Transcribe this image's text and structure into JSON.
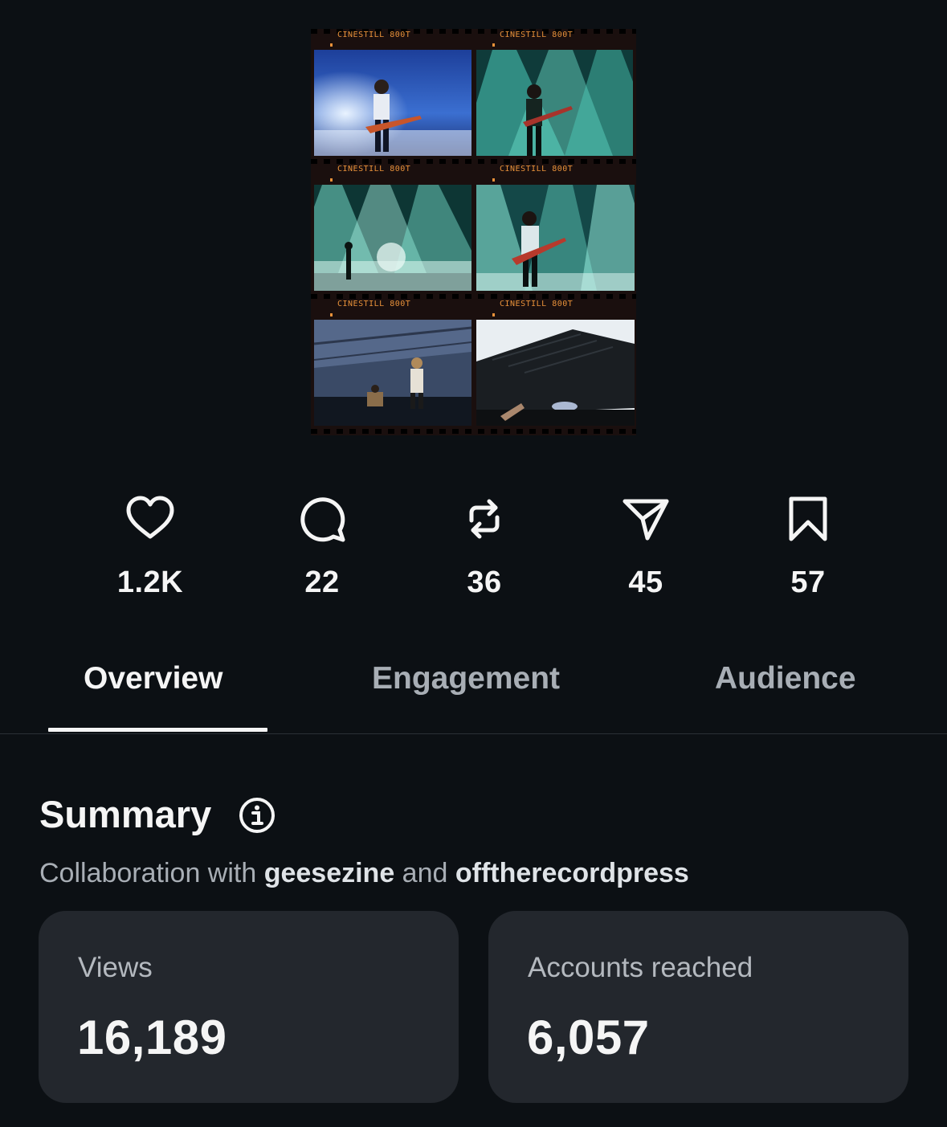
{
  "post": {
    "frames": [
      {
        "label": "CINESTILL 800T",
        "scene": "guitarist-blue-stage"
      },
      {
        "label": "CINESTILL 800T",
        "scene": "guitarist-teal-beams"
      },
      {
        "label": "CINESTILL 800T",
        "scene": "stage-teal-beams-wide"
      },
      {
        "label": "CINESTILL 800T",
        "scene": "guitarist-teal-closeup"
      },
      {
        "label": "",
        "scene": "band-stage-wide"
      },
      {
        "label": "",
        "scene": "crowd-under-tent"
      }
    ],
    "frame_labels_row3": [
      "CINESTILL 800T",
      "CINESTILL 800T"
    ]
  },
  "stats": [
    {
      "icon": "heart-icon",
      "value": "1.2K"
    },
    {
      "icon": "comment-icon",
      "value": "22"
    },
    {
      "icon": "repost-icon",
      "value": "36"
    },
    {
      "icon": "share-icon",
      "value": "45"
    },
    {
      "icon": "bookmark-icon",
      "value": "57"
    }
  ],
  "tabs": [
    {
      "label": "Overview",
      "active": true
    },
    {
      "label": "Engagement",
      "active": false
    },
    {
      "label": "Audience",
      "active": false
    }
  ],
  "summary": {
    "title": "Summary",
    "collab_prefix": "Collaboration with ",
    "collab_user_1": "geesezine",
    "collab_joiner": " and ",
    "collab_user_2": "offtherecordpress"
  },
  "metrics": [
    {
      "label": "Views",
      "value": "16,189"
    },
    {
      "label": "Accounts reached",
      "value": "6,057"
    }
  ],
  "colors": {
    "background": "#0c1014",
    "card": "#23272d",
    "text_primary": "#f5f5f5",
    "text_secondary": "#a8aeb5",
    "film_label": "#e8913a"
  }
}
